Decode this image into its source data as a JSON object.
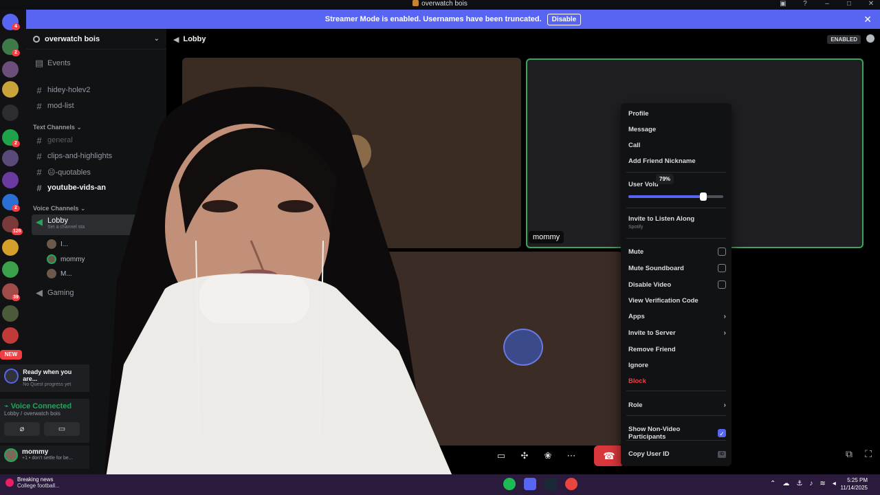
{
  "window": {
    "title": "overwatch bois"
  },
  "banner": {
    "text": "Streamer Mode is enabled. Usernames have been truncated.",
    "button": "Disable"
  },
  "rail": {
    "badges": [
      "4",
      "2",
      "2",
      "2",
      "126",
      "39"
    ],
    "new_label": "NEW"
  },
  "sidebar": {
    "server_name": "overwatch bois",
    "events": "Events",
    "channels_top": [
      "hidey-holev2",
      "mod-list"
    ],
    "text_category": "Text Channels",
    "text_channels": [
      "general",
      "clips-and-highlights",
      "😐-quotables",
      "youtube-vids-an"
    ],
    "voice_category": "Voice Channels",
    "voice_channel": "Lobby",
    "voice_status": "Set a channel sta",
    "voice_users": [
      "I...",
      "mommy",
      "M..."
    ],
    "gaming": "Gaming"
  },
  "quest": {
    "title": "Ready when you are...",
    "sub": "No Quest progress yet"
  },
  "voice": {
    "status": "Voice Connected",
    "location": "Lobby / overwatch bois"
  },
  "user": {
    "name": "mommy",
    "status": "+1 • don't settle for be..."
  },
  "main": {
    "channel": "Lobby",
    "enabled_badge": "ENABLED",
    "tile_label": "mommy"
  },
  "menu": {
    "profile": "Profile",
    "message": "Message",
    "call": "Call",
    "add_nickname": "Add Friend Nickname",
    "user_volume": "User Volu",
    "volume_tooltip": "79%",
    "volume_value": 0.79,
    "invite_listen": "Invite to Listen Along",
    "invite_listen_sub": "Spotify",
    "mute": "Mute",
    "mute_soundboard": "Mute Soundboard",
    "disable_video": "Disable Video",
    "view_verification": "View Verification Code",
    "apps": "Apps",
    "invite_server": "Invite to Server",
    "remove_friend": "Remove Friend",
    "ignore": "Ignore",
    "block": "Block",
    "role": "Role",
    "show_nonvideo": "Show Non-Video Participants",
    "copy_user_id": "Copy User ID",
    "id_icon": "ID"
  },
  "taskbar": {
    "news_title": "Breaking news",
    "news_sub": "College football...",
    "time": "5:25 PM",
    "date": "11/14/2025"
  }
}
